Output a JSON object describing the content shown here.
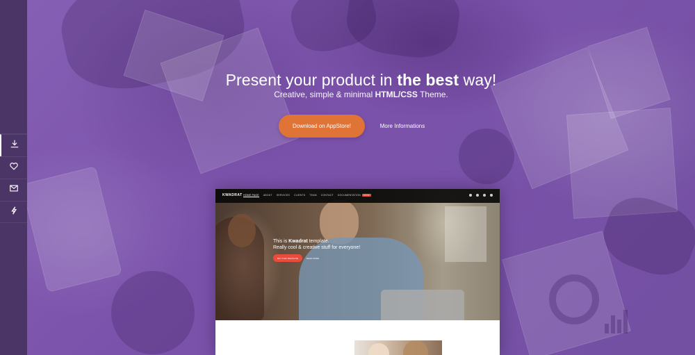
{
  "hero": {
    "headline_pre": "Present your product in ",
    "headline_bold": "the best",
    "headline_post": " way!",
    "sub_pre": "Creative, simple & minimal ",
    "sub_bold": "HTML/CSS",
    "sub_post": " Theme."
  },
  "buttons": {
    "download": "Download on AppStore!",
    "more": "More Informations"
  },
  "sidebar": {
    "items": [
      {
        "icon": "download-icon",
        "active": true
      },
      {
        "icon": "heart-icon",
        "active": false
      },
      {
        "icon": "mail-icon",
        "active": false
      },
      {
        "icon": "bolt-icon",
        "active": false
      }
    ]
  },
  "preview": {
    "brand": "KWADRAT",
    "menu": [
      "HOME PAGE",
      "ABOUT",
      "SERVICES",
      "CLIENTS",
      "TEAM",
      "CONTACT",
      "DOCUMENTATION"
    ],
    "menu_badge": "NEW",
    "title_pre": "This is ",
    "title_bold": "Kwadrat",
    "title_post": " template.",
    "subtitle": "Really cool & creative stuff for everyone!",
    "btn_primary": "BUY THIS TEMPLATE",
    "btn_secondary": "READ MORE"
  },
  "colors": {
    "accent": "#e07336",
    "background": "#7a52a8",
    "sidebar": "#4a3566",
    "preview_accent": "#e94b3c"
  }
}
